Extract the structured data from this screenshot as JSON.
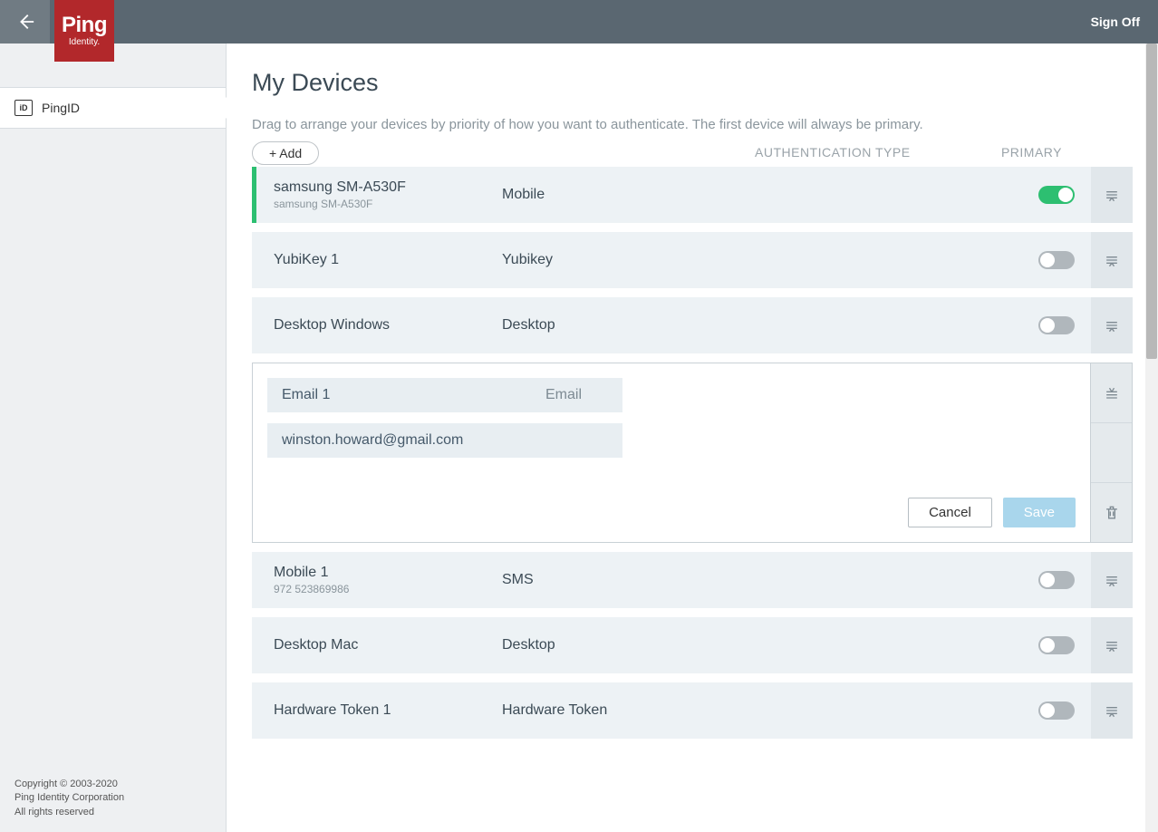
{
  "topbar": {
    "sign_off": "Sign Off"
  },
  "logo": {
    "line1": "Ping",
    "line2": "Identity."
  },
  "sidebar": {
    "items": [
      {
        "label": "PingID"
      }
    ],
    "copyright": {
      "line1": "Copyright © 2003-2020",
      "line2": "Ping Identity Corporation",
      "line3": "All rights reserved"
    }
  },
  "page": {
    "title": "My Devices",
    "subtitle": "Drag to arrange your devices by priority of how you want to authenticate. The first device will always be primary.",
    "add_label": "+ Add",
    "columns": {
      "auth": "AUTHENTICATION TYPE",
      "primary": "PRIMARY"
    }
  },
  "devices": [
    {
      "name": "samsung SM-A530F",
      "sub": "samsung SM-A530F",
      "type": "Mobile",
      "primary": true,
      "accent": true
    },
    {
      "name": "YubiKey 1",
      "sub": "",
      "type": "Yubikey",
      "primary": false
    },
    {
      "name": "Desktop Windows",
      "sub": "",
      "type": "Desktop",
      "primary": false
    }
  ],
  "editing": {
    "name": "Email 1",
    "type": "Email",
    "value": "winston.howard@gmail.com",
    "cancel": "Cancel",
    "save": "Save"
  },
  "devices_after": [
    {
      "name": "Mobile 1",
      "sub": "972 523869986",
      "type": "SMS",
      "primary": false
    },
    {
      "name": "Desktop Mac",
      "sub": "",
      "type": "Desktop",
      "primary": false
    },
    {
      "name": "Hardware Token 1",
      "sub": "",
      "type": "Hardware Token",
      "primary": false
    }
  ]
}
